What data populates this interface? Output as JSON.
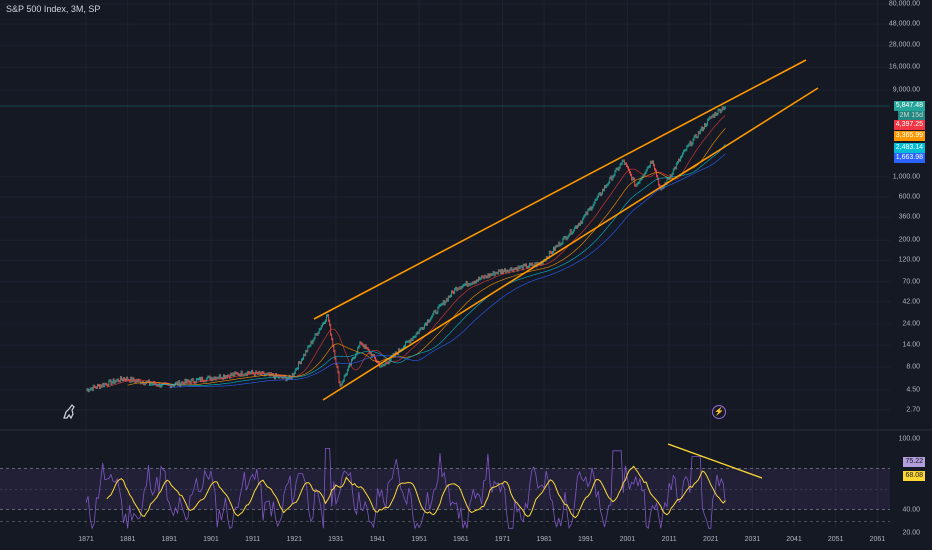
{
  "chart_title": "S&P 500 Index, 3M, SP",
  "price_axis": [
    "80,000.00",
    "48,000.00",
    "28,000.00",
    "16,000.00",
    "9,000.00",
    "5,847.48",
    "2M 15d",
    "4,397.25",
    "3,365.99",
    "2,483.14",
    "1,663.98",
    "1,000.00",
    "600.00",
    "360.00",
    "200.00",
    "120.00",
    "70.00",
    "42.00",
    "24.00",
    "14.00",
    "8.00",
    "4.50",
    "2.70"
  ],
  "rsi_axis": [
    "100.00",
    "75.22",
    "68.08",
    "40.00",
    "20.00"
  ],
  "time_axis": [
    "1871",
    "1881",
    "1891",
    "1901",
    "1911",
    "1921",
    "1931",
    "1941",
    "1951",
    "1961",
    "1971",
    "1981",
    "1991",
    "2001",
    "2011",
    "2021",
    "2031",
    "2041",
    "2051",
    "2061"
  ],
  "colors": {
    "background": "#151924",
    "channel": "#ff9800",
    "price_up": "#26a69a",
    "price_down": "#ef5350",
    "ma_red": "#e53935",
    "ma_orange": "#ff9800",
    "ma_teal": "#00bcd4",
    "ma_blue": "#2962ff",
    "rsi_line": "#7e57c2",
    "rsi_ma": "#fdd835",
    "rsi_band": "#7e57c2"
  },
  "price_tags": [
    {
      "label": "5,847.48",
      "sub": "2M 15d",
      "color": "#26a69a"
    },
    {
      "label": "4,397.25",
      "color": "#f23645"
    },
    {
      "label": "3,365.99",
      "color": "#ff9800"
    },
    {
      "label": "2,483.14",
      "color": "#00bcd4"
    },
    {
      "label": "1,663.98",
      "color": "#2962ff"
    }
  ],
  "rsi_tags": [
    {
      "label": "75.22",
      "color": "#b39ddb"
    },
    {
      "label": "68.08",
      "color": "#fdd835"
    }
  ],
  "icons": {
    "logo": "dinosaur-icon",
    "indicator": "lightning-icon"
  },
  "chart_data": {
    "type": "line",
    "title": "S&P 500 Index, 3M, SP",
    "scale": "log",
    "x_range": [
      1871,
      2061
    ],
    "y_range": [
      2.7,
      80000
    ],
    "series": [
      {
        "name": "",
        "x": [
          1871,
          1880,
          1890,
          1900,
          1910,
          1920,
          1929,
          1932,
          1937,
          1942,
          1950,
          1960,
          1970,
          1980,
          1990,
          2000,
          2003,
          2007,
          2009,
          2015,
          2021,
          2024
        ],
        "values": [
          4.5,
          6,
          5,
          6,
          7,
          6,
          30,
          5,
          15,
          8,
          18,
          60,
          90,
          110,
          330,
          1500,
          800,
          1550,
          700,
          2000,
          4500,
          5847.48
        ]
      }
    ],
    "rsi": {
      "band": [
        40,
        75
      ],
      "last_values": [
        75.22,
        68.08
      ],
      "ylim": [
        20,
        100
      ]
    },
    "grid": true
  }
}
